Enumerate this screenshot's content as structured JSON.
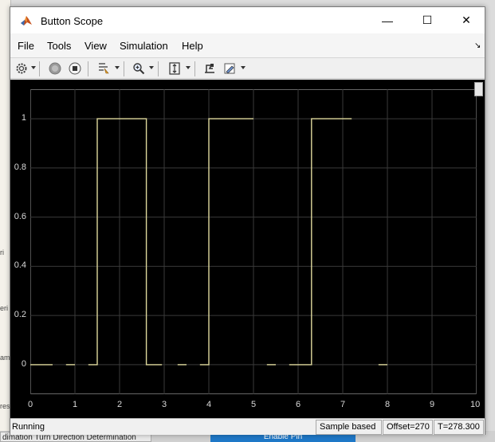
{
  "window": {
    "title": "Button Scope",
    "controls": {
      "minimize": "—",
      "maximize": "☐",
      "close": "✕"
    }
  },
  "menu": [
    "File",
    "Tools",
    "View",
    "Simulation",
    "Help"
  ],
  "toolbar": {
    "icons": [
      "gear-icon",
      "run-icon",
      "stop-icon",
      "highlight-icon",
      "zoom-icon",
      "fit-axes-icon",
      "cursor-icon",
      "style-icon"
    ]
  },
  "status": {
    "state": "Running",
    "mode": "Sample based",
    "offset": "Offset=270",
    "time": "T=278.300"
  },
  "background": {
    "left_fragments": [
      "ri",
      "eri",
      "am",
      "res"
    ],
    "tab1": "dimation Turn Direction Determination",
    "tab2": "Enable Pin"
  },
  "colors": {
    "plot_background": "#000000",
    "grid": "#3a3a3a",
    "axis_text": "#d8d8d8",
    "signal": "#ded89c"
  },
  "chart_data": {
    "type": "line",
    "xlim": [
      0,
      10
    ],
    "ylim": [
      -0.12,
      1.12
    ],
    "x_ticks": [
      0,
      1,
      2,
      3,
      4,
      5,
      6,
      7,
      8,
      9,
      10
    ],
    "y_ticks": [
      0,
      0.2,
      0.4,
      0.6,
      0.8,
      1
    ],
    "x_tick_labels": [
      "0",
      "1",
      "2",
      "3",
      "4",
      "5",
      "6",
      "7",
      "8",
      "9",
      "10"
    ],
    "y_tick_labels": [
      "0",
      "0.2",
      "0.4",
      "0.6",
      "0.8",
      "1"
    ],
    "grid": true,
    "series": [
      {
        "segments": [
          {
            "x": [
              0.0,
              0.5
            ],
            "y": [
              0,
              0
            ]
          },
          {
            "x": [
              0.8,
              1.0
            ],
            "y": [
              0,
              0
            ]
          },
          {
            "x": [
              1.3,
              1.5,
              1.5,
              2.6,
              2.6,
              2.95
            ],
            "y": [
              0,
              0,
              1,
              1,
              0,
              0
            ]
          },
          {
            "x": [
              3.3,
              3.5
            ],
            "y": [
              0,
              0
            ]
          },
          {
            "x": [
              3.8,
              4.0,
              4.0,
              5.0
            ],
            "y": [
              0,
              0,
              1,
              1
            ]
          },
          {
            "x": [
              5.3,
              5.5
            ],
            "y": [
              0,
              0
            ]
          },
          {
            "x": [
              5.8,
              6.3,
              6.3,
              7.2
            ],
            "y": [
              0,
              0,
              1,
              1
            ]
          },
          {
            "x": [
              7.8,
              8.0
            ],
            "y": [
              0,
              0
            ]
          }
        ]
      }
    ]
  }
}
